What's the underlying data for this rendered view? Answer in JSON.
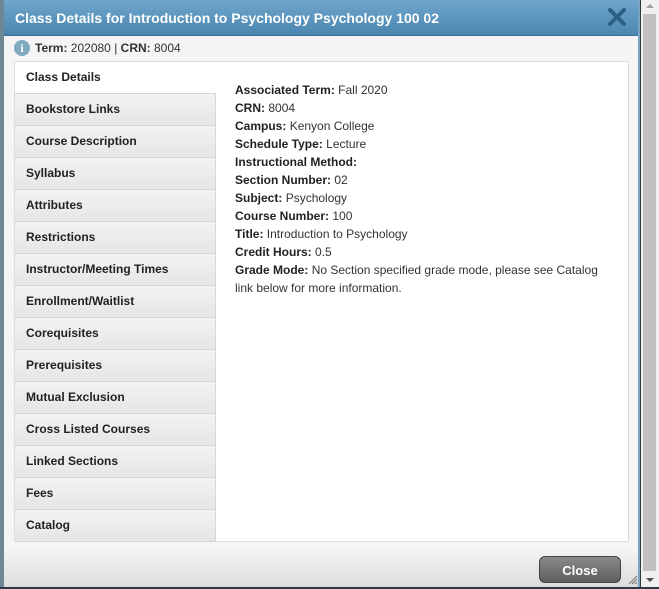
{
  "dialog": {
    "title": "Class Details for Introduction to Psychology Psychology 100 02",
    "term_label": "Term:",
    "term_value": "202080",
    "separator": "|",
    "crn_label": "CRN:",
    "crn_value": "8004",
    "close_button": "Close"
  },
  "tabs": [
    {
      "label": "Class Details",
      "active": true
    },
    {
      "label": "Bookstore Links"
    },
    {
      "label": "Course Description"
    },
    {
      "label": "Syllabus"
    },
    {
      "label": "Attributes"
    },
    {
      "label": "Restrictions"
    },
    {
      "label": "Instructor/Meeting Times"
    },
    {
      "label": "Enrollment/Waitlist"
    },
    {
      "label": "Corequisites"
    },
    {
      "label": "Prerequisites"
    },
    {
      "label": "Mutual Exclusion"
    },
    {
      "label": "Cross Listed Courses"
    },
    {
      "label": "Linked Sections"
    },
    {
      "label": "Fees"
    },
    {
      "label": "Catalog"
    }
  ],
  "details": [
    {
      "label": "Associated Term:",
      "value": "Fall 2020"
    },
    {
      "label": "CRN:",
      "value": "8004"
    },
    {
      "label": "Campus:",
      "value": "Kenyon College"
    },
    {
      "label": "Schedule Type:",
      "value": "Lecture"
    },
    {
      "label": "Instructional Method:",
      "value": ""
    },
    {
      "label": "Section Number:",
      "value": "02"
    },
    {
      "label": "Subject:",
      "value": "Psychology"
    },
    {
      "label": "Course Number:",
      "value": "100"
    },
    {
      "label": "Title:",
      "value": "Introduction to Psychology"
    },
    {
      "label": "Credit Hours:",
      "value": "0.5"
    },
    {
      "label": "Grade Mode:",
      "value": "No Section specified grade mode, please see Catalog link below for more information."
    }
  ]
}
